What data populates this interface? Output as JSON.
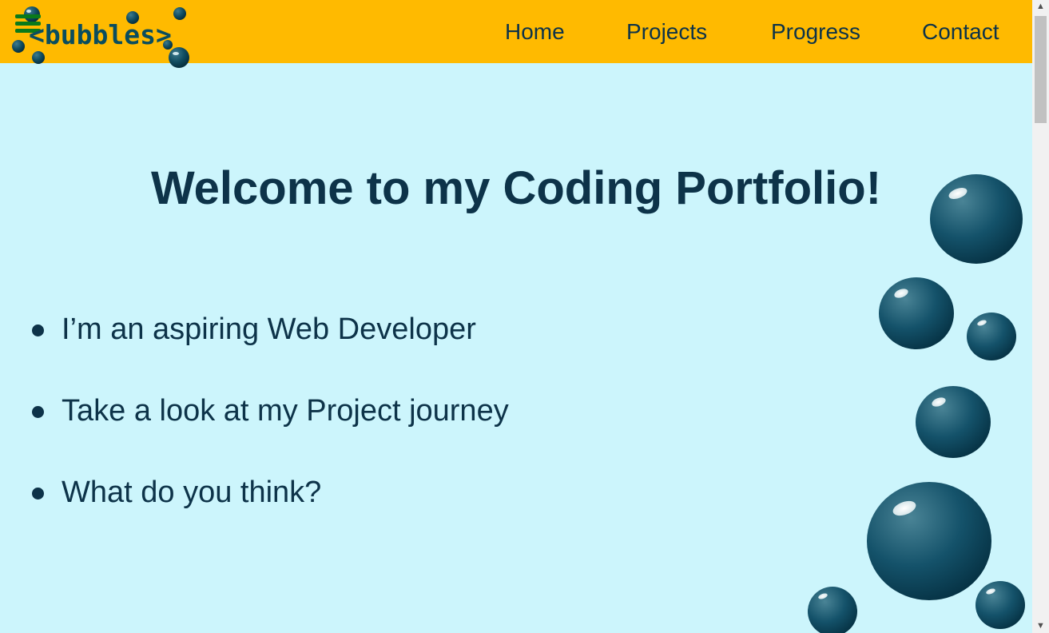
{
  "logo": {
    "text": "<bubbles>"
  },
  "nav": {
    "items": [
      {
        "label": "Home"
      },
      {
        "label": "Projects"
      },
      {
        "label": "Progress"
      },
      {
        "label": "Contact"
      }
    ]
  },
  "main": {
    "heading": "Welcome to my Coding Portfolio!",
    "bullets": [
      "I’m an aspiring Web Developer",
      "Take a look at my Project journey",
      "What do you think?"
    ]
  },
  "colors": {
    "navbar": "#ffba00",
    "background": "#ccf5fc",
    "text": "#0d3349",
    "bubble": "#0f4a5e"
  },
  "icons": {
    "menu": "hamburger-menu-icon",
    "bubble": "bubble-icon"
  }
}
